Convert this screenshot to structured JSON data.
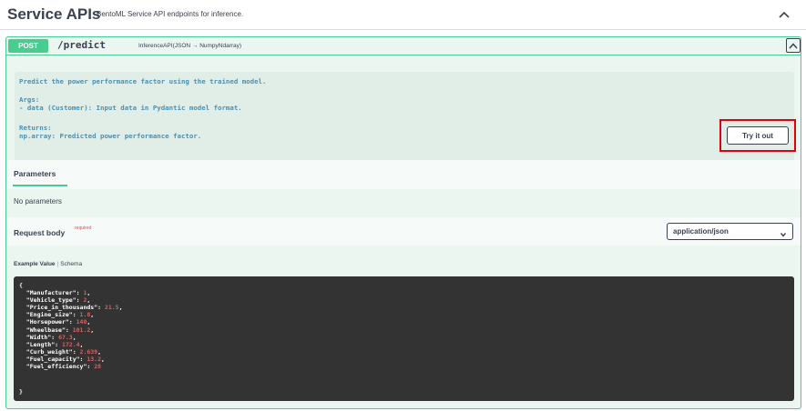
{
  "section": {
    "title": "Service APIs",
    "description": "BentoML Service API endpoints for inference."
  },
  "operation": {
    "method": "POST",
    "path": "/predict",
    "summary": "InferenceAPI(JSON → NumpyNdarray)",
    "doc_lines": [
      "Predict the power performance factor using the trained model.",
      "Args:",
      "- data (Customer): Input data in Pydantic model format.",
      "Returns:",
      "np.array: Predicted power performance factor."
    ]
  },
  "parameters": {
    "tab_label": "Parameters",
    "try_button": "Try it out",
    "empty_text": "No parameters"
  },
  "request_body": {
    "label": "Request body",
    "required_label": "required",
    "content_type": "application/json"
  },
  "example": {
    "tab_example": "Example Value",
    "tab_schema": "Schema",
    "open_brace": "{",
    "fields": [
      {
        "key": "\"Manufacturer\": ",
        "value": "1",
        "sep": ","
      },
      {
        "key": "\"Vehicle_type\": ",
        "value": "2",
        "sep": ","
      },
      {
        "key": "\"Price_in_thousands\": ",
        "value": "21.5",
        "sep": ","
      },
      {
        "key": "\"Engine_size\": ",
        "value": "1.8",
        "sep": ","
      },
      {
        "key": "\"Horsepower\": ",
        "value": "140",
        "sep": ","
      },
      {
        "key": "\"Wheelbase\": ",
        "value": "101.2",
        "sep": ","
      },
      {
        "key": "\"Width\": ",
        "value": "67.3",
        "sep": ","
      },
      {
        "key": "\"Length\": ",
        "value": "172.4",
        "sep": ","
      },
      {
        "key": "\"Curb_weight\": ",
        "value": "2.639",
        "sep": ","
      },
      {
        "key": "\"Fuel_capacity\": ",
        "value": "13.2",
        "sep": ","
      },
      {
        "key": "\"Fuel_efficiency\": ",
        "value": "28",
        "sep": ""
      }
    ],
    "close_brace": "}"
  },
  "colors": {
    "post_green": "#49cc90",
    "opblock_bg": "#ebf6f1",
    "highlight_red": "#e3000b",
    "code_bg": "#333333",
    "number_color": "#d36363"
  }
}
